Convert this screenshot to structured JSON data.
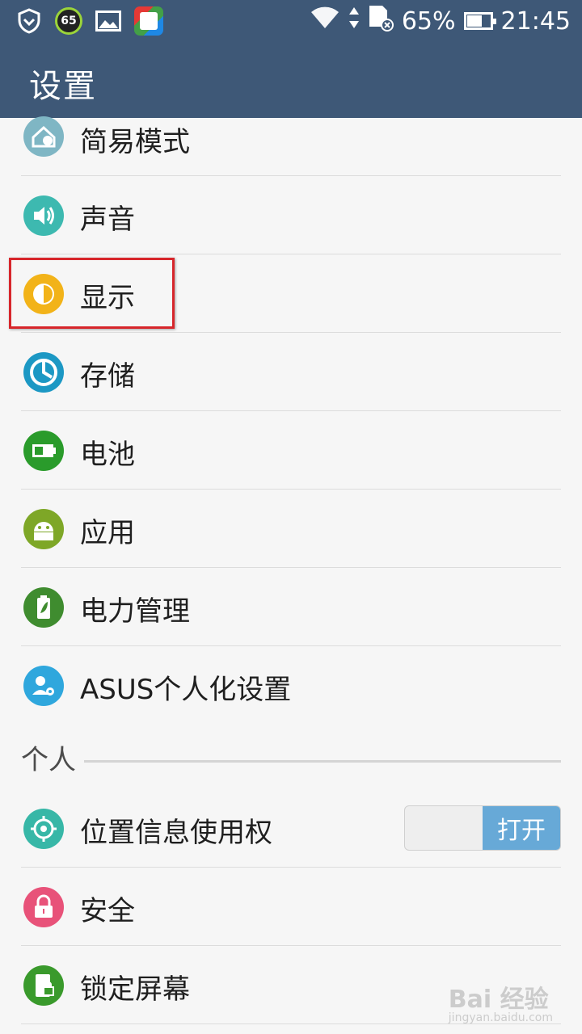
{
  "status_bar": {
    "badge_number": "65",
    "battery_percent": "65%",
    "battery_level": 0.65,
    "time": "21:45",
    "icons": [
      "shield-icon",
      "badge-icon",
      "image-icon",
      "app-icon",
      "wifi-icon",
      "data-transfer-icon",
      "sd-card-icon",
      "battery-icon"
    ]
  },
  "header": {
    "title": "设置"
  },
  "settings": {
    "items_top": [
      {
        "label": "简易模式",
        "icon": "easy-mode-icon",
        "color": "#7fb6c4"
      },
      {
        "label": "声音",
        "icon": "sound-icon",
        "color": "#3db9b0"
      },
      {
        "label": "显示",
        "icon": "display-icon",
        "color": "#f2b319"
      },
      {
        "label": "存储",
        "icon": "storage-icon",
        "color": "#1c98c4"
      },
      {
        "label": "电池",
        "icon": "battery-icon",
        "color": "#2a9b2b"
      },
      {
        "label": "应用",
        "icon": "android-icon",
        "color": "#7ea727"
      },
      {
        "label": "电力管理",
        "icon": "power-management-icon",
        "color": "#3f8c2f"
      },
      {
        "label": "ASUS个人化设置",
        "icon": "asus-customize-icon",
        "color": "#2fa7dd"
      }
    ],
    "section_personal": "个人",
    "items_personal": [
      {
        "label": "位置信息使用权",
        "icon": "location-icon",
        "color": "#37b7a7",
        "toggle": "打开"
      },
      {
        "label": "安全",
        "icon": "lock-icon",
        "color": "#e85279"
      },
      {
        "label": "锁定屏幕",
        "icon": "lock-screen-icon",
        "color": "#3a9a2c"
      }
    ]
  },
  "watermark": {
    "main": "Bai 经验",
    "sub": "jingyan.baidu.com"
  },
  "colors": {
    "bar": "#3e5877",
    "highlight": "#d7262b",
    "toggle_on": "#67a9d7"
  }
}
